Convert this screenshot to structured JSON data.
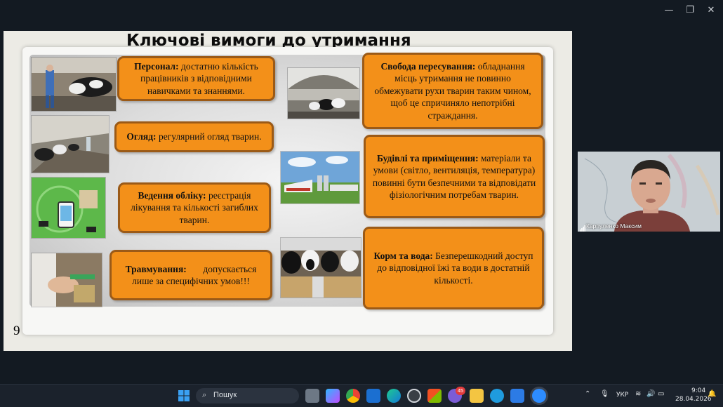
{
  "window": {
    "controls": [
      {
        "name": "minimize-button",
        "label": "—"
      },
      {
        "name": "restore-button",
        "label": "❐"
      },
      {
        "name": "close-button",
        "label": "✕"
      }
    ]
  },
  "slide": {
    "title": "Ключові вимоги до утримання",
    "number": "9",
    "cards": [
      {
        "heading": "Персонал:",
        "text": " достатню кількість працівників з відповідними навичками та знаннями."
      },
      {
        "heading": "Огляд:",
        "text": " регулярний огляд тварин."
      },
      {
        "heading": "Ведення обліку:",
        "text": " реєстрація лікування та кількості загиблих тварин."
      },
      {
        "heading": "Травмування:",
        "text": "       допускається лише за специфічних умов!!!"
      },
      {
        "heading": "Свобода пересування:",
        "text": " обладнання місць утримання не повинно обмежувати рухи тварин таким чином, щоб це спричиняло непотрібні страждання."
      },
      {
        "heading": "Будівлі та приміщення:",
        "text": " матеріали та умови (світло, вентиляція, температура) повинні бути безпечними та відповідати фізіологічним потребам тварин."
      },
      {
        "heading": "Корм та вода:",
        "text": " Безперешкодний доступ до відповідної їжі та води в достатній кількості."
      }
    ]
  },
  "webcam": {
    "participant_name": "Карпуленко Максим"
  },
  "taskbar": {
    "search_placeholder": "Пошук",
    "notification_badge": "45",
    "language": "УКР",
    "time": "9:04",
    "date": "28.04.2026"
  }
}
